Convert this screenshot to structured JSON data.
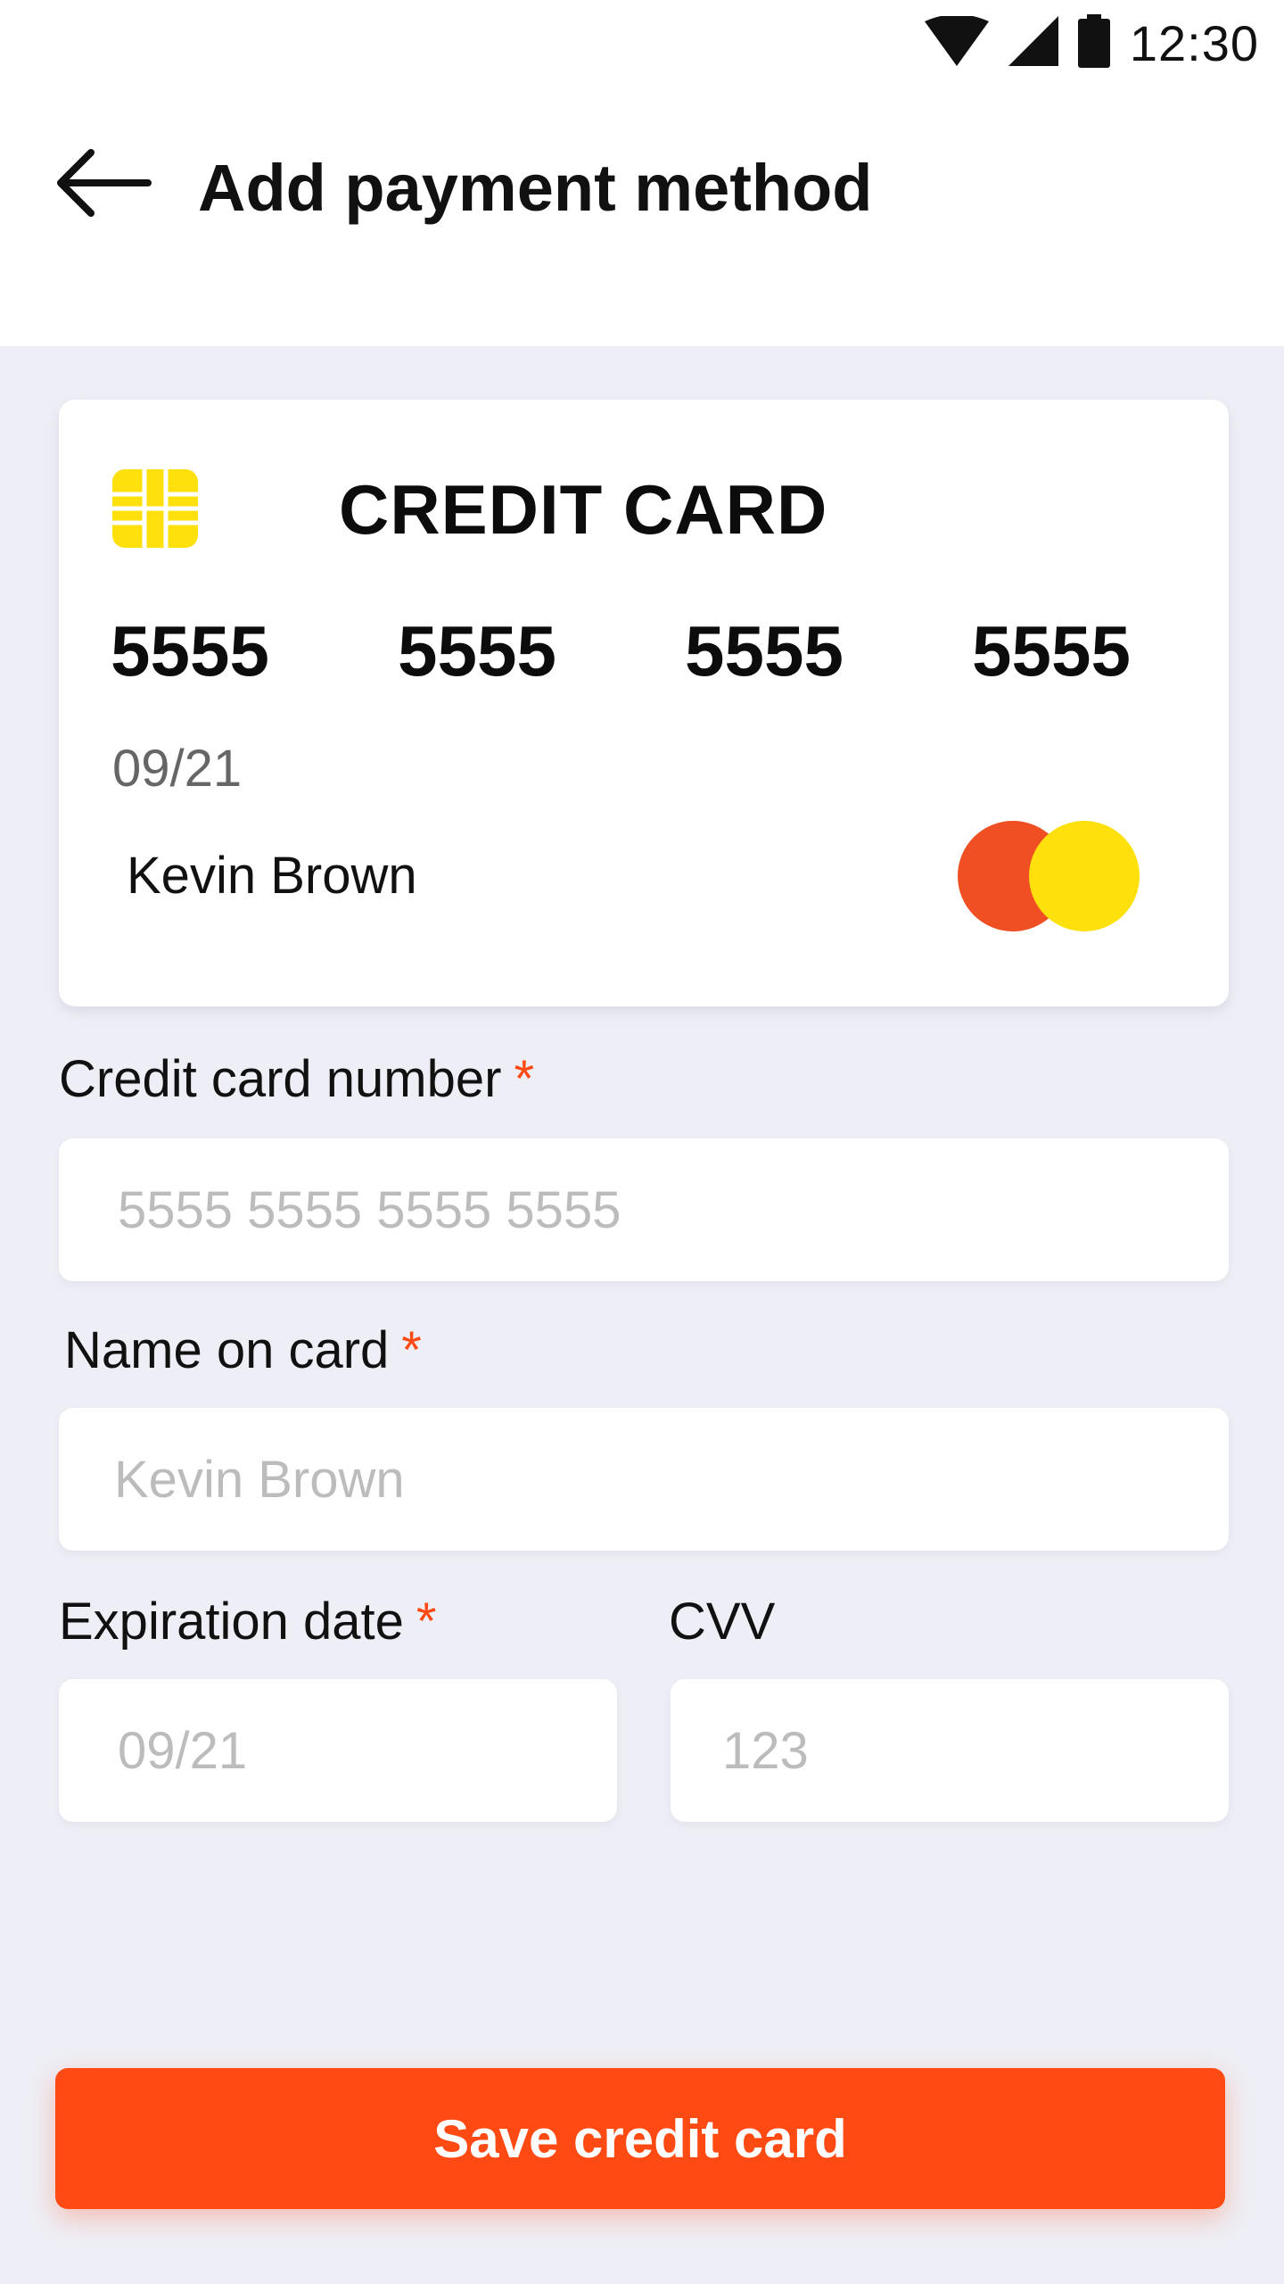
{
  "status_bar": {
    "time": "12:30",
    "icons": [
      "wifi-icon",
      "signal-icon",
      "battery-icon"
    ]
  },
  "header": {
    "back_icon": "arrow-left-icon",
    "title": "Add payment method"
  },
  "card_preview": {
    "chip_icon": "card-chip-icon",
    "title": "CREDIT CARD",
    "number_groups": [
      "5555",
      "5555",
      "5555",
      "5555"
    ],
    "expiry": "09/21",
    "holder": "Kevin Brown",
    "brand_icon": "mastercard-logo",
    "brand_colors": [
      "#ef4f23",
      "#fde00c"
    ]
  },
  "form": {
    "card_number": {
      "label": "Credit card number",
      "required_mark": "*",
      "value": "",
      "placeholder": "5555 5555 5555 5555"
    },
    "name": {
      "label": "Name on card",
      "required_mark": "*",
      "value": "",
      "placeholder": "Kevin Brown"
    },
    "expiration": {
      "label": "Expiration date",
      "required_mark": "*",
      "value": "",
      "placeholder": "09/21"
    },
    "cvv": {
      "label": "CVV",
      "value": "",
      "placeholder": "123"
    }
  },
  "actions": {
    "save_label": "Save credit card"
  },
  "colors": {
    "accent": "#ff4a14",
    "chip": "#fde00c",
    "background": "#eeeff6",
    "surface": "#ffffff"
  }
}
